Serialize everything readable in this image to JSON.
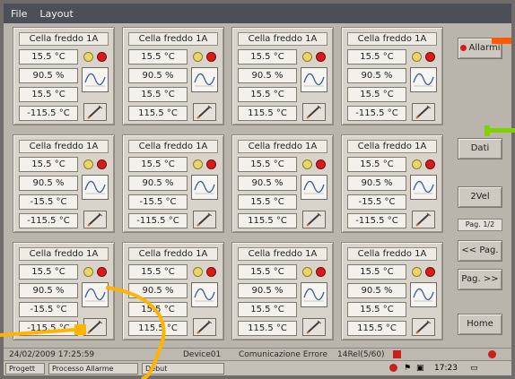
{
  "menu": [
    "File",
    "Layout"
  ],
  "panels": [
    {
      "title": "Cella freddo 1A",
      "temp": "15.5 °C",
      "hum": "90.5 %",
      "set1": "15.5 °C",
      "set2": "-115.5 °C"
    },
    {
      "title": "Cella freddo 1A",
      "temp": "15.5 °C",
      "hum": "90.5 %",
      "set1": "15.5 °C",
      "set2": "115.5 °C"
    },
    {
      "title": "Cella freddo 1A",
      "temp": "15.5 °C",
      "hum": "90.5 %",
      "set1": "15.5 °C",
      "set2": "115.5 °C"
    },
    {
      "title": "Cella freddo 1A",
      "temp": "15.5 °C",
      "hum": "90.5 %",
      "set1": "15.5 °C",
      "set2": "-115.5 °C"
    },
    {
      "title": "Cella freddo 1A",
      "temp": "15.5 °C",
      "hum": "90.5 %",
      "set1": "-15.5 °C",
      "set2": "-115.5 °C"
    },
    {
      "title": "Cella freddo 1A",
      "temp": "15.5 °C",
      "hum": "90.5 %",
      "set1": "-15.5 °C",
      "set2": "-115.5 °C"
    },
    {
      "title": "Cella freddo 1A",
      "temp": "15.5 °C",
      "hum": "90.5 %",
      "set1": "15.5 °C",
      "set2": "115.5 °C"
    },
    {
      "title": "Cella freddo 1A",
      "temp": "15.5 °C",
      "hum": "90.5 %",
      "set1": "-15.5 °C",
      "set2": "-115.5 °C"
    },
    {
      "title": "Cella freddo 1A",
      "temp": "15.5 °C",
      "hum": "90.5 %",
      "set1": "-15.5 °C",
      "set2": "-115.5 °C"
    },
    {
      "title": "Cella freddo 1A",
      "temp": "15.5 °C",
      "hum": "90.5 %",
      "set1": "15.5 °C",
      "set2": "115.5 °C"
    },
    {
      "title": "Cella freddo 1A",
      "temp": "15.5 °C",
      "hum": "90.5 %",
      "set1": "15.5 °C",
      "set2": "115.5 °C"
    },
    {
      "title": "Cella freddo 1A",
      "temp": "15.5 °C",
      "hum": "90.5 %",
      "set1": "15.5 °C",
      "set2": "115.5 °C"
    }
  ],
  "side": {
    "alarms_label": "Allarmi",
    "btn2_label": "Dati",
    "btn3_label": "2Vel",
    "page_indicator": "Pag. 1/2",
    "prev_label": "<< Pag.",
    "next_label": "Pag. >>",
    "home_label": "Home"
  },
  "status": {
    "datetime": "24/02/2009 17:25:59",
    "device": "Device01",
    "message": "Comunicazione Errore",
    "code": "14Rel(5/60)"
  },
  "taskbar": {
    "start_label": "Progett",
    "item1_label": "Processo Allarme",
    "item2_label": "Debut",
    "clock": "17:23"
  },
  "colors": {
    "alarm_red": "#d81a1a",
    "warn_yellow": "#e8d66a",
    "marker_orange": "#ff5a00",
    "marker_green": "#7fd200",
    "annotation_yellow": "#ffb400"
  }
}
